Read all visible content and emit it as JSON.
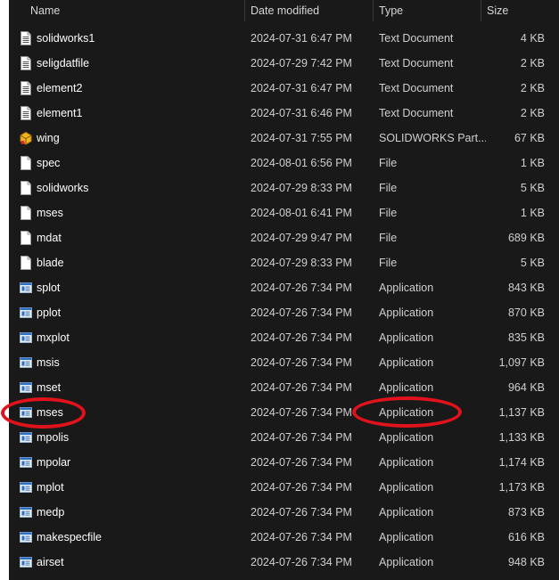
{
  "header": {
    "name": "Name",
    "date": "Date modified",
    "type": "Type",
    "size": "Size"
  },
  "files": [
    {
      "name": "solidworks1",
      "date": "2024-07-31 6:47 PM",
      "type": "Text Document",
      "size": "4 KB",
      "icon": "text-document-icon"
    },
    {
      "name": "seligdatfile",
      "date": "2024-07-29 7:42 PM",
      "type": "Text Document",
      "size": "2 KB",
      "icon": "text-document-icon"
    },
    {
      "name": "element2",
      "date": "2024-07-31 6:47 PM",
      "type": "Text Document",
      "size": "2 KB",
      "icon": "text-document-icon"
    },
    {
      "name": "element1",
      "date": "2024-07-31 6:46 PM",
      "type": "Text Document",
      "size": "2 KB",
      "icon": "text-document-icon"
    },
    {
      "name": "wing",
      "date": "2024-07-31 7:55 PM",
      "type": "SOLIDWORKS Part...",
      "size": "67 KB",
      "icon": "solidworks-part-icon"
    },
    {
      "name": "spec",
      "date": "2024-08-01 6:56 PM",
      "type": "File",
      "size": "1 KB",
      "icon": "blank-file-icon"
    },
    {
      "name": "solidworks",
      "date": "2024-07-29 8:33 PM",
      "type": "File",
      "size": "5 KB",
      "icon": "blank-file-icon"
    },
    {
      "name": "mses",
      "date": "2024-08-01 6:41 PM",
      "type": "File",
      "size": "1 KB",
      "icon": "blank-file-icon"
    },
    {
      "name": "mdat",
      "date": "2024-07-29 9:47 PM",
      "type": "File",
      "size": "689 KB",
      "icon": "blank-file-icon"
    },
    {
      "name": "blade",
      "date": "2024-07-29 8:33 PM",
      "type": "File",
      "size": "5 KB",
      "icon": "blank-file-icon"
    },
    {
      "name": "splot",
      "date": "2024-07-26 7:34 PM",
      "type": "Application",
      "size": "843 KB",
      "icon": "application-icon"
    },
    {
      "name": "pplot",
      "date": "2024-07-26 7:34 PM",
      "type": "Application",
      "size": "870 KB",
      "icon": "application-icon"
    },
    {
      "name": "mxplot",
      "date": "2024-07-26 7:34 PM",
      "type": "Application",
      "size": "835 KB",
      "icon": "application-icon"
    },
    {
      "name": "msis",
      "date": "2024-07-26 7:34 PM",
      "type": "Application",
      "size": "1,097 KB",
      "icon": "application-icon"
    },
    {
      "name": "mset",
      "date": "2024-07-26 7:34 PM",
      "type": "Application",
      "size": "964 KB",
      "icon": "application-icon"
    },
    {
      "name": "mses",
      "date": "2024-07-26 7:34 PM",
      "type": "Application",
      "size": "1,137 KB",
      "icon": "application-icon"
    },
    {
      "name": "mpolis",
      "date": "2024-07-26 7:34 PM",
      "type": "Application",
      "size": "1,133 KB",
      "icon": "application-icon"
    },
    {
      "name": "mpolar",
      "date": "2024-07-26 7:34 PM",
      "type": "Application",
      "size": "1,174 KB",
      "icon": "application-icon"
    },
    {
      "name": "mplot",
      "date": "2024-07-26 7:34 PM",
      "type": "Application",
      "size": "1,173 KB",
      "icon": "application-icon"
    },
    {
      "name": "medp",
      "date": "2024-07-26 7:34 PM",
      "type": "Application",
      "size": "873 KB",
      "icon": "application-icon"
    },
    {
      "name": "makespecfile",
      "date": "2024-07-26 7:34 PM",
      "type": "Application",
      "size": "616 KB",
      "icon": "application-icon"
    },
    {
      "name": "airset",
      "date": "2024-07-26 7:34 PM",
      "type": "Application",
      "size": "948 KB",
      "icon": "application-icon"
    }
  ],
  "colors": {
    "background": "#191919",
    "text": "#ffffff",
    "secondary_text": "#cfcfcf",
    "annotation": "#e0121b"
  }
}
